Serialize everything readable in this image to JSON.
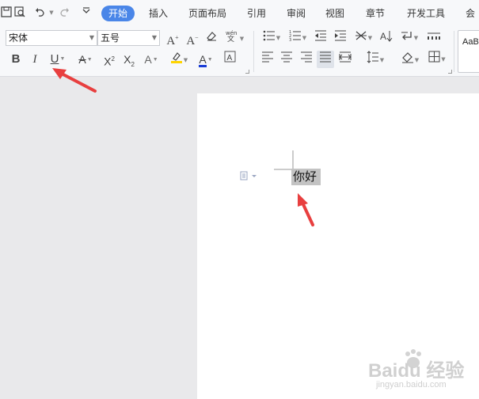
{
  "quick_access": {
    "icons": [
      "print-preview-icon",
      "undo-icon",
      "redo-icon",
      "customize-icon"
    ]
  },
  "tabs": [
    {
      "label": "开始",
      "active": true
    },
    {
      "label": "插入"
    },
    {
      "label": "页面布局"
    },
    {
      "label": "引用"
    },
    {
      "label": "审阅"
    },
    {
      "label": "视图"
    },
    {
      "label": "章节"
    },
    {
      "label": "开发工具"
    },
    {
      "label": "会"
    }
  ],
  "font": {
    "name": "宋体",
    "size": "五号"
  },
  "styles": {
    "preview": "AaB"
  },
  "document": {
    "selected_text": "你好"
  },
  "watermark": {
    "logo": "Baidu 经验",
    "url": "jingyan.baidu.com"
  },
  "colors": {
    "accent": "#4a86e8",
    "arrow": "#e83f3f",
    "highlight": "#ffd400",
    "font_color": "#1a3dd6",
    "selection": "#c3c3c3"
  }
}
